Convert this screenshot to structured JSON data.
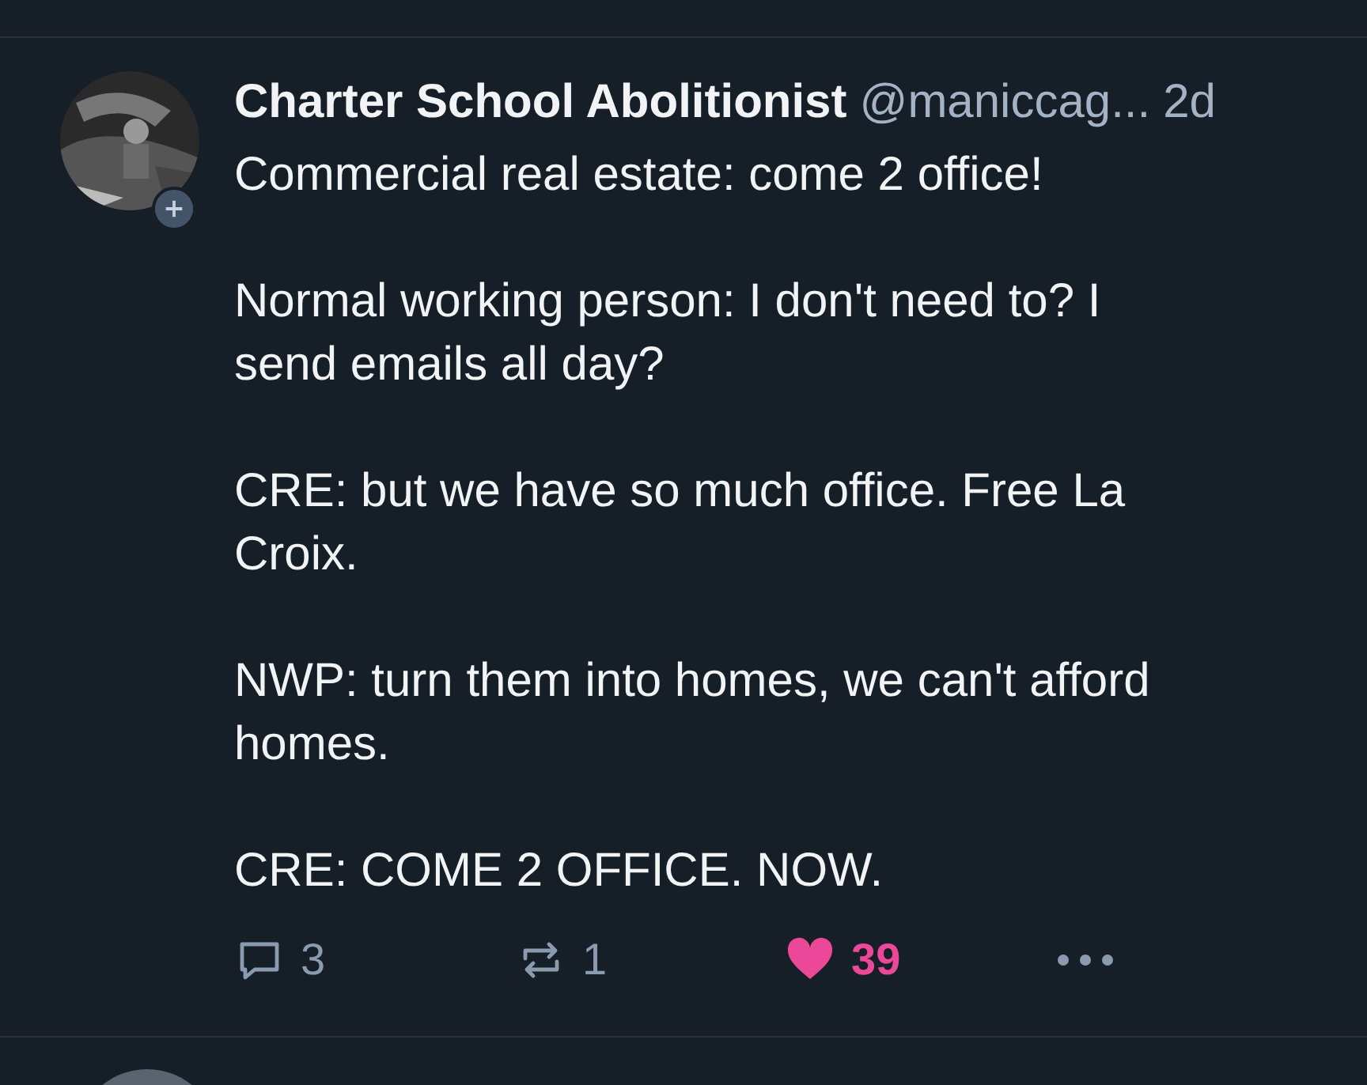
{
  "post": {
    "author": "Charter School Abolitionist",
    "handle": "@maniccag...",
    "time": "2d",
    "text": "Commercial real estate: come 2 office!\n\nNormal working person: I don't need to? I send emails all day?\n\nCRE: but we have so much office. Free La Croix.\n\nNWP: turn them into homes, we can't afford homes.\n\nCRE: COME 2 OFFICE. NOW.",
    "actions": {
      "replies": "3",
      "reposts": "1",
      "likes": "39",
      "liked": true
    }
  }
}
